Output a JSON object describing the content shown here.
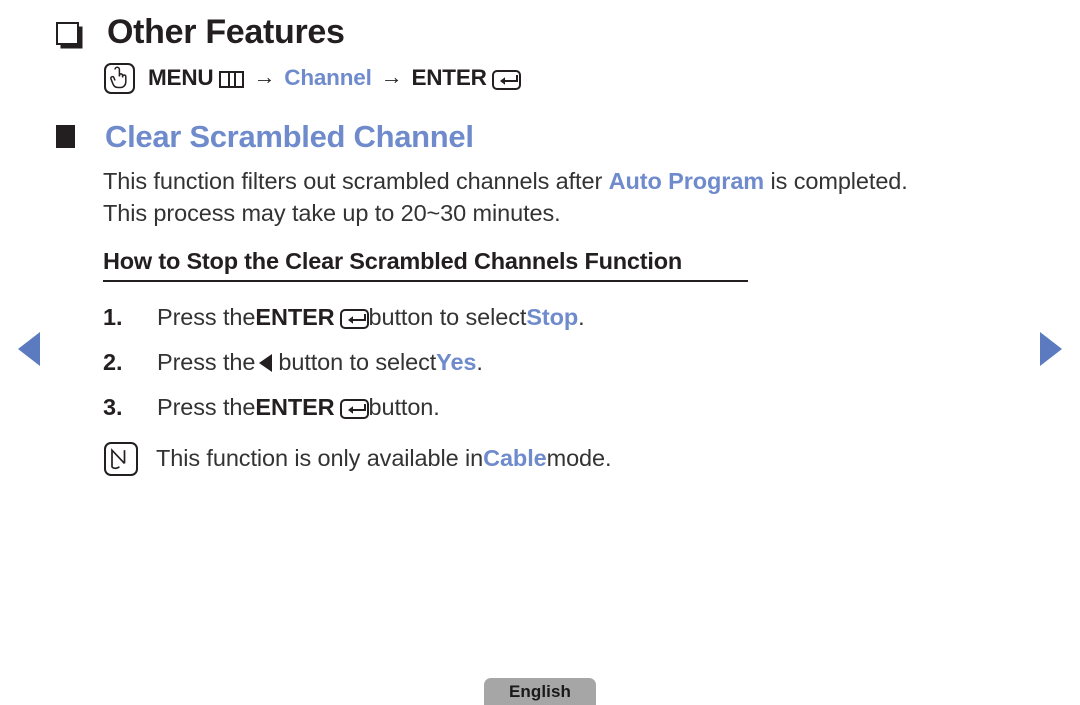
{
  "nav": {
    "prev_label": "previous page",
    "next_label": "next page"
  },
  "section": {
    "bullet_icon": "hollow-square-shadow-icon",
    "title": "Other Features",
    "menu_path": {
      "touch_icon": "hand-touch-icon",
      "menu_label": "MENU",
      "menu_grid_icon": "menu-grid-icon",
      "arrow1": "→",
      "channel_label": "Channel",
      "arrow2": "→",
      "enter_label": "ENTER",
      "enter_icon": "enter-return-icon"
    }
  },
  "topic": {
    "bullet_icon": "filled-square-icon",
    "heading": "Clear Scrambled Channel",
    "paragraph": {
      "line1_a": "This function filters out scrambled channels after ",
      "line1_highlight": "Auto Program",
      "line1_b": " is completed.",
      "line2": "This process may take up to 20~30 minutes."
    },
    "howto_heading": "How to Stop the Clear Scrambled Channels Function",
    "steps": [
      {
        "num": "1.",
        "pre": "Press the ",
        "key": "ENTER",
        "key_icon": "enter-return-icon",
        "mid": " button to select ",
        "highlight": "Stop",
        "post": "."
      },
      {
        "num": "2.",
        "pre": "Press the ",
        "key_icon": "left-triangle-icon",
        "mid": " button to select ",
        "highlight": "Yes",
        "post": "."
      },
      {
        "num": "3.",
        "pre": "Press the ",
        "key": "ENTER",
        "key_icon": "enter-return-icon",
        "mid": " button.",
        "highlight": "",
        "post": ""
      }
    ],
    "note": {
      "icon": "note-pencil-icon",
      "pre": "This function is only available in ",
      "highlight": "Cable",
      "post": " mode."
    }
  },
  "footer": {
    "language_label": "English"
  },
  "colors": {
    "accent_blue": "#6f8bcc",
    "nav_blue": "#5b7ac0",
    "text_black": "#231f20",
    "chip_gray": "#a6a6a6"
  }
}
